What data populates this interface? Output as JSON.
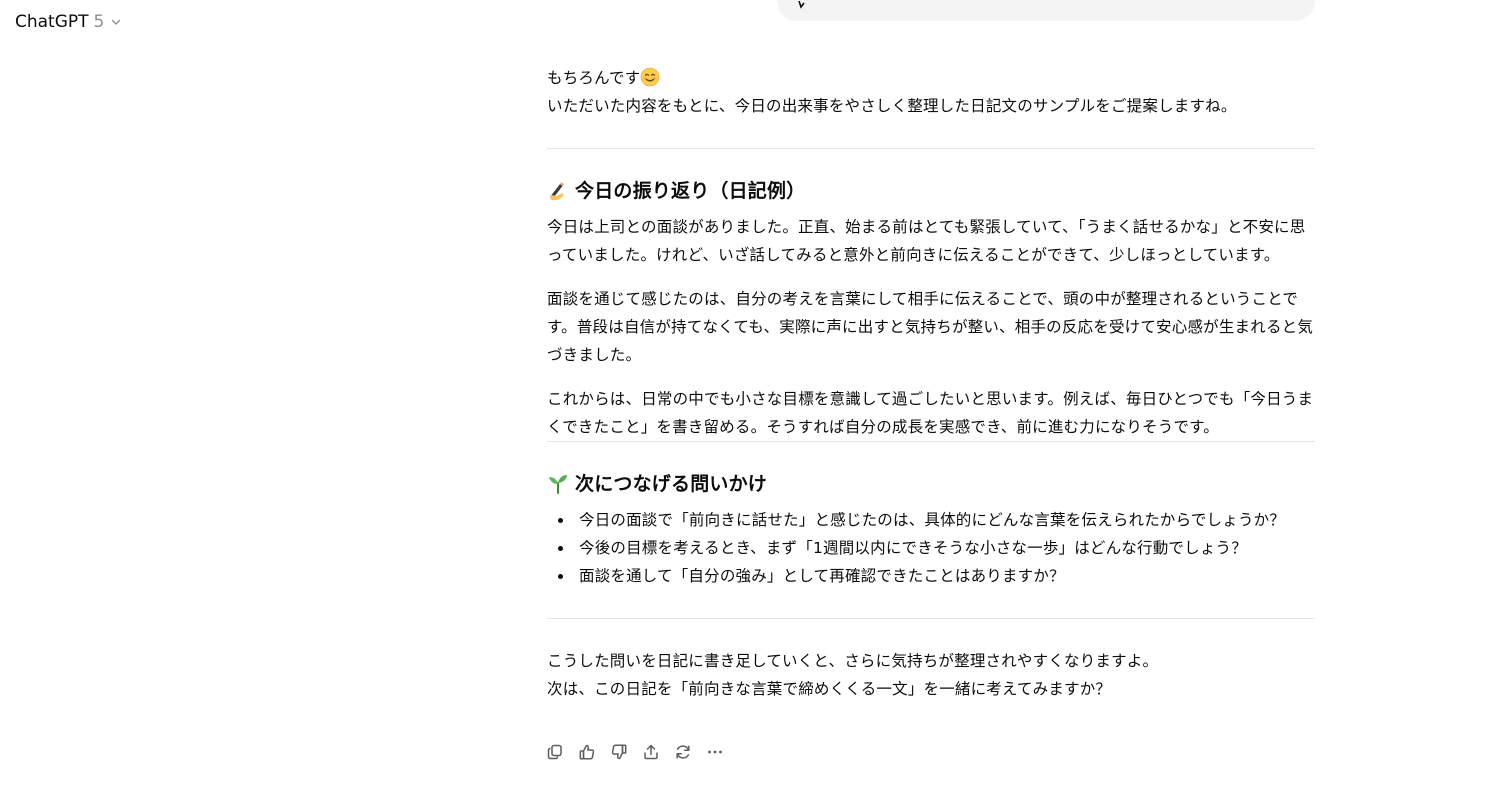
{
  "header": {
    "app_name": "ChatGPT",
    "model_version": "5"
  },
  "assistant_message": {
    "intro_lines": [
      "もちろんです",
      "いただいた内容をもとに、今日の出来事をやさしく整理した日記文のサンプルをご提案しますね。"
    ],
    "section1": {
      "heading": "今日の振り返り（日記例）",
      "icon": "writing-hand-icon",
      "paragraphs": [
        "今日は上司との面談がありました。正直、始まる前はとても緊張していて、「うまく話せるかな」と不安に思っていました。けれど、いざ話してみると意外と前向きに伝えることができて、少しほっとしています。",
        "面談を通じて感じたのは、自分の考えを言葉にして相手に伝えることで、頭の中が整理されるということです。普段は自信が持てなくても、実際に声に出すと気持ちが整い、相手の反応を受けて安心感が生まれると気づきました。",
        "これからは、日常の中でも小さな目標を意識して過ごしたいと思います。例えば、毎日ひとつでも「今日うまくできたこと」を書き留める。そうすれば自分の成長を実感でき、前に進む力になりそうです。"
      ]
    },
    "section2": {
      "heading": "次につなげる問いかけ",
      "icon": "seedling-icon",
      "items": [
        "今日の面談で「前向きに話せた」と感じたのは、具体的にどんな言葉を伝えられたからでしょうか？",
        "今後の目標を考えるとき、まず「1週間以内にできそうな小さな一歩」はどんな行動でしょう？",
        "面談を通して「自分の強み」として再確認できたことはありますか？"
      ]
    },
    "closing_lines": [
      "こうした問いを日記に書き足していくと、さらに気持ちが整理されやすくなりますよ。",
      "次は、この日記を「前向きな言葉で締めくくる一文」を一緒に考えてみますか？"
    ]
  },
  "actions": [
    {
      "name": "copy-button",
      "icon": "copy-icon"
    },
    {
      "name": "thumbs-up-button",
      "icon": "thumbs-up-icon"
    },
    {
      "name": "thumbs-down-button",
      "icon": "thumbs-down-icon"
    },
    {
      "name": "share-button",
      "icon": "share-icon"
    },
    {
      "name": "regenerate-button",
      "icon": "regenerate-icon"
    },
    {
      "name": "more-button",
      "icon": "more-icon"
    }
  ],
  "colors": {
    "text": "#0d0d0d",
    "muted": "#8f8f8f",
    "bubble": "#f4f4f4",
    "divider": "#e5e5e5",
    "icon": "#5d5d5d"
  }
}
